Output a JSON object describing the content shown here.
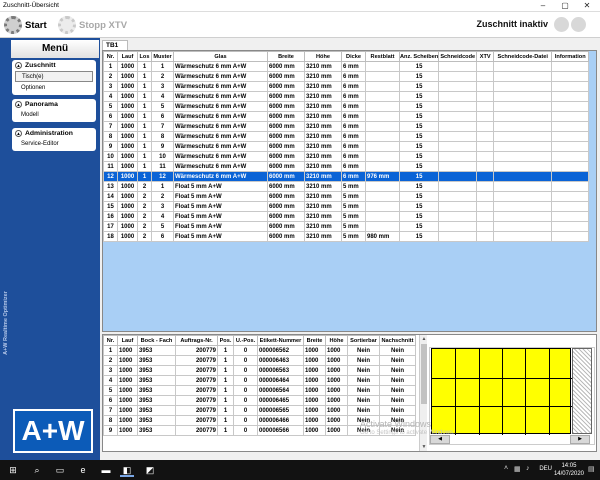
{
  "window": {
    "title": "Zuschnitt-Übersicht"
  },
  "toolbar": {
    "start_label": "Start",
    "stop_label": "Stopp XTV",
    "status": "Zuschnitt inaktiv"
  },
  "sidebar": {
    "title": "Menü",
    "sections": [
      {
        "label": "Zuschnitt",
        "items": [
          "Tisch(e)",
          "Optionen"
        ]
      },
      {
        "label": "Panorama",
        "items": [
          "Modell"
        ]
      },
      {
        "label": "Administration",
        "items": [
          "Service-Editor"
        ]
      }
    ],
    "vertical_text": "A+W Realtime Optimizer",
    "logo": "A+W"
  },
  "main": {
    "tab_label": "TB1",
    "table1": {
      "columns": [
        "Nr.",
        "Lauf",
        "Los",
        "Muster",
        "Glas",
        "Breite",
        "Höhe",
        "Dicke",
        "Restblatt",
        "Anz. Scheiben",
        "Schneidcode",
        "XTV",
        "Schneidcode-Datei",
        "Information"
      ],
      "rows": [
        [
          "1",
          "1000",
          "1",
          "1",
          "Wärmeschutz 6 mm  A+W",
          "6000 mm",
          "3210 mm",
          "6 mm",
          "",
          "15",
          "",
          "",
          "",
          ""
        ],
        [
          "2",
          "1000",
          "1",
          "2",
          "Wärmeschutz 6 mm  A+W",
          "6000 mm",
          "3210 mm",
          "6 mm",
          "",
          "15",
          "",
          "",
          "",
          ""
        ],
        [
          "3",
          "1000",
          "1",
          "3",
          "Wärmeschutz 6 mm  A+W",
          "6000 mm",
          "3210 mm",
          "6 mm",
          "",
          "15",
          "",
          "",
          "",
          ""
        ],
        [
          "4",
          "1000",
          "1",
          "4",
          "Wärmeschutz 6 mm  A+W",
          "6000 mm",
          "3210 mm",
          "6 mm",
          "",
          "15",
          "",
          "",
          "",
          ""
        ],
        [
          "5",
          "1000",
          "1",
          "5",
          "Wärmeschutz 6 mm  A+W",
          "6000 mm",
          "3210 mm",
          "6 mm",
          "",
          "15",
          "",
          "",
          "",
          ""
        ],
        [
          "6",
          "1000",
          "1",
          "6",
          "Wärmeschutz 6 mm  A+W",
          "6000 mm",
          "3210 mm",
          "6 mm",
          "",
          "15",
          "",
          "",
          "",
          ""
        ],
        [
          "7",
          "1000",
          "1",
          "7",
          "Wärmeschutz 6 mm  A+W",
          "6000 mm",
          "3210 mm",
          "6 mm",
          "",
          "15",
          "",
          "",
          "",
          ""
        ],
        [
          "8",
          "1000",
          "1",
          "8",
          "Wärmeschutz 6 mm  A+W",
          "6000 mm",
          "3210 mm",
          "6 mm",
          "",
          "15",
          "",
          "",
          "",
          ""
        ],
        [
          "9",
          "1000",
          "1",
          "9",
          "Wärmeschutz 6 mm  A+W",
          "6000 mm",
          "3210 mm",
          "6 mm",
          "",
          "15",
          "",
          "",
          "",
          ""
        ],
        [
          "10",
          "1000",
          "1",
          "10",
          "Wärmeschutz 6 mm  A+W",
          "6000 mm",
          "3210 mm",
          "6 mm",
          "",
          "15",
          "",
          "",
          "",
          ""
        ],
        [
          "11",
          "1000",
          "1",
          "11",
          "Wärmeschutz 6 mm  A+W",
          "6000 mm",
          "3210 mm",
          "6 mm",
          "",
          "15",
          "",
          "",
          "",
          ""
        ],
        [
          "12",
          "1000",
          "1",
          "12",
          "Wärmeschutz 6 mm  A+W",
          "6000 mm",
          "3210 mm",
          "6 mm",
          "976 mm",
          "15",
          "",
          "",
          "",
          ""
        ],
        [
          "13",
          "1000",
          "2",
          "1",
          "Float 5 mm A+W",
          "6000 mm",
          "3210 mm",
          "5 mm",
          "",
          "15",
          "",
          "",
          "",
          ""
        ],
        [
          "14",
          "1000",
          "2",
          "2",
          "Float 5 mm A+W",
          "6000 mm",
          "3210 mm",
          "5 mm",
          "",
          "15",
          "",
          "",
          "",
          ""
        ],
        [
          "15",
          "1000",
          "2",
          "3",
          "Float 5 mm A+W",
          "6000 mm",
          "3210 mm",
          "5 mm",
          "",
          "15",
          "",
          "",
          "",
          ""
        ],
        [
          "16",
          "1000",
          "2",
          "4",
          "Float 5 mm A+W",
          "6000 mm",
          "3210 mm",
          "5 mm",
          "",
          "15",
          "",
          "",
          "",
          ""
        ],
        [
          "17",
          "1000",
          "2",
          "5",
          "Float 5 mm A+W",
          "6000 mm",
          "3210 mm",
          "5 mm",
          "",
          "15",
          "",
          "",
          "",
          ""
        ],
        [
          "18",
          "1000",
          "2",
          "6",
          "Float 5 mm A+W",
          "6000 mm",
          "3210 mm",
          "5 mm",
          "980 mm",
          "15",
          "",
          "",
          "",
          ""
        ]
      ],
      "selected_index": 11
    },
    "table2": {
      "columns": [
        "Nr.",
        "Lauf",
        "Bock - Fach",
        "Auftrags-Nr.",
        "Pos.",
        "U.-Pos.",
        "Etikett-Nummer",
        "Breite",
        "Höhe",
        "Sortierbar",
        "Nachschnitt"
      ],
      "rows": [
        [
          "1",
          "1000",
          "3953",
          "200779",
          "1",
          "0",
          "000006562",
          "1000",
          "1000",
          "Nein",
          "Nein"
        ],
        [
          "2",
          "1000",
          "3953",
          "200779",
          "1",
          "0",
          "000006463",
          "1000",
          "1000",
          "Nein",
          "Nein"
        ],
        [
          "3",
          "1000",
          "3953",
          "200779",
          "1",
          "0",
          "000006563",
          "1000",
          "1000",
          "Nein",
          "Nein"
        ],
        [
          "4",
          "1000",
          "3953",
          "200779",
          "1",
          "0",
          "000006464",
          "1000",
          "1000",
          "Nein",
          "Nein"
        ],
        [
          "5",
          "1000",
          "3953",
          "200779",
          "1",
          "0",
          "000006564",
          "1000",
          "1000",
          "Nein",
          "Nein"
        ],
        [
          "6",
          "1000",
          "3953",
          "200779",
          "1",
          "0",
          "000006465",
          "1000",
          "1000",
          "Nein",
          "Nein"
        ],
        [
          "7",
          "1000",
          "3953",
          "200779",
          "1",
          "0",
          "000006565",
          "1000",
          "1000",
          "Nein",
          "Nein"
        ],
        [
          "8",
          "1000",
          "3953",
          "200779",
          "1",
          "0",
          "000006466",
          "1000",
          "1000",
          "Nein",
          "Nein"
        ],
        [
          "9",
          "1000",
          "3953",
          "200779",
          "1",
          "0",
          "000006566",
          "1000",
          "1000",
          "Nein",
          "Nein"
        ]
      ]
    },
    "cut_plan": {
      "sheet_color": "#ffff00",
      "columns": 6,
      "rows": 3
    }
  },
  "watermark": {
    "line1": "Activate Windows",
    "line2": "Go to Settings to activate Windows."
  },
  "taskbar": {
    "time": "14:05",
    "date": "14/07/2020",
    "language": "DEU"
  },
  "colors": {
    "sidebar": "#1e4f9b",
    "selection": "#0a63d6",
    "grid_bg": "#a9cff5"
  }
}
